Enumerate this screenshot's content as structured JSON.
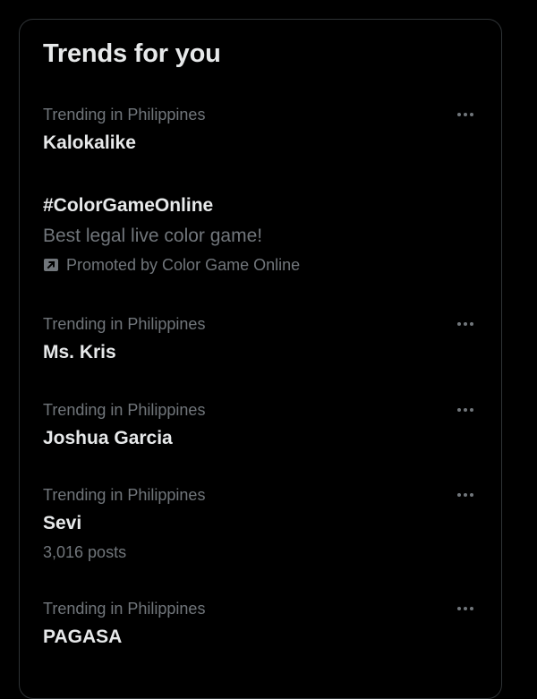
{
  "panel": {
    "title": "Trends for you"
  },
  "trends": [
    {
      "context": "Trending in Philippines",
      "name": "Kalokalike"
    },
    {
      "context": "Trending in Philippines",
      "name": "Ms. Kris"
    },
    {
      "context": "Trending in Philippines",
      "name": "Joshua Garcia"
    },
    {
      "context": "Trending in Philippines",
      "name": "Sevi",
      "posts": "3,016 posts"
    },
    {
      "context": "Trending in Philippines",
      "name": "PAGASA"
    }
  ],
  "promoted": {
    "name": "#ColorGameOnline",
    "description": "Best legal live color game!",
    "by": "Promoted by Color Game Online",
    "icon": "promoted-arrow-icon"
  },
  "icons": {
    "more": "more-options-icon"
  },
  "colors": {
    "background": "#000000",
    "primary_text": "#e7e9ea",
    "secondary_text": "#71767b",
    "border": "#2f3336"
  }
}
